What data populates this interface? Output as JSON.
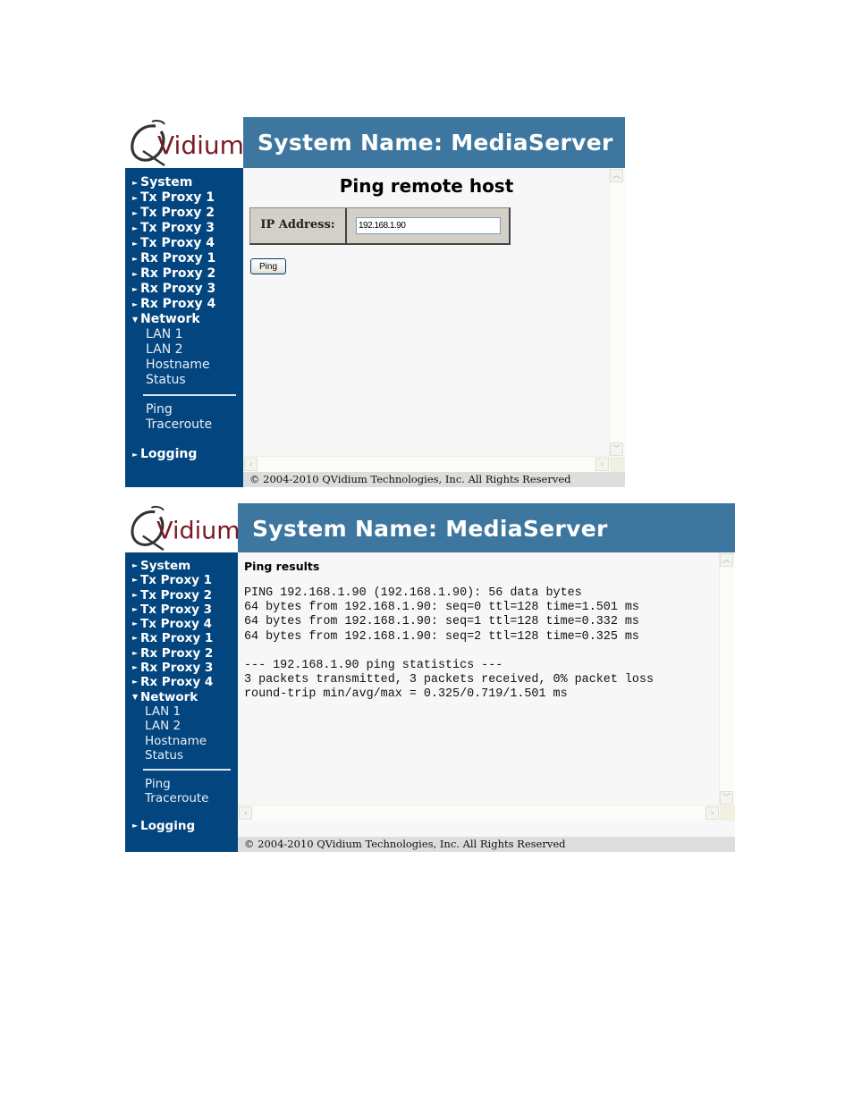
{
  "brand": {
    "logo_text": "Vidium",
    "header_title": "System Name: MediaServer"
  },
  "sidebar": {
    "items": [
      {
        "label": "System",
        "arrow": "►"
      },
      {
        "label": "Tx Proxy 1",
        "arrow": "►"
      },
      {
        "label": "Tx Proxy 2",
        "arrow": "►"
      },
      {
        "label": "Tx Proxy 3",
        "arrow": "►"
      },
      {
        "label": "Tx Proxy 4",
        "arrow": "►"
      },
      {
        "label": "Rx Proxy 1",
        "arrow": "►"
      },
      {
        "label": "Rx Proxy 2",
        "arrow": "►"
      },
      {
        "label": "Rx Proxy 3",
        "arrow": "►"
      },
      {
        "label": "Rx Proxy 4",
        "arrow": "►"
      },
      {
        "label": "Network",
        "arrow": "▼"
      }
    ],
    "network_sub": [
      "LAN 1",
      "LAN 2",
      "Hostname",
      "Status"
    ],
    "tools_sub": [
      "Ping",
      "Traceroute"
    ],
    "logging": {
      "label": "Logging",
      "arrow": "►"
    }
  },
  "ping_form": {
    "title": "Ping remote host",
    "ip_label": "IP Address:",
    "ip_value": "192.168.1.90",
    "button_label": "Ping"
  },
  "ping_results": {
    "title": "Ping results",
    "lines": [
      "PING 192.168.1.90 (192.168.1.90): 56 data bytes",
      "64 bytes from 192.168.1.90: seq=0 ttl=128 time=1.501 ms",
      "64 bytes from 192.168.1.90: seq=1 ttl=128 time=0.332 ms",
      "64 bytes from 192.168.1.90: seq=2 ttl=128 time=0.325 ms",
      "",
      "--- 192.168.1.90 ping statistics ---",
      "3 packets transmitted, 3 packets received, 0% packet loss",
      "round-trip min/avg/max = 0.325/0.719/1.501 ms"
    ]
  },
  "footer": {
    "copyright": "© 2004-2010 QVidium Technologies, Inc.   All Rights Reserved"
  },
  "scroll": {
    "up": "︿",
    "down": "﹀",
    "left": "‹",
    "right": "›"
  },
  "colors": {
    "header_bg": "#3d77a0",
    "sidebar_bg": "#03457f",
    "logo_text": "#7a1a24",
    "content_bg": "#f7f7f7"
  }
}
